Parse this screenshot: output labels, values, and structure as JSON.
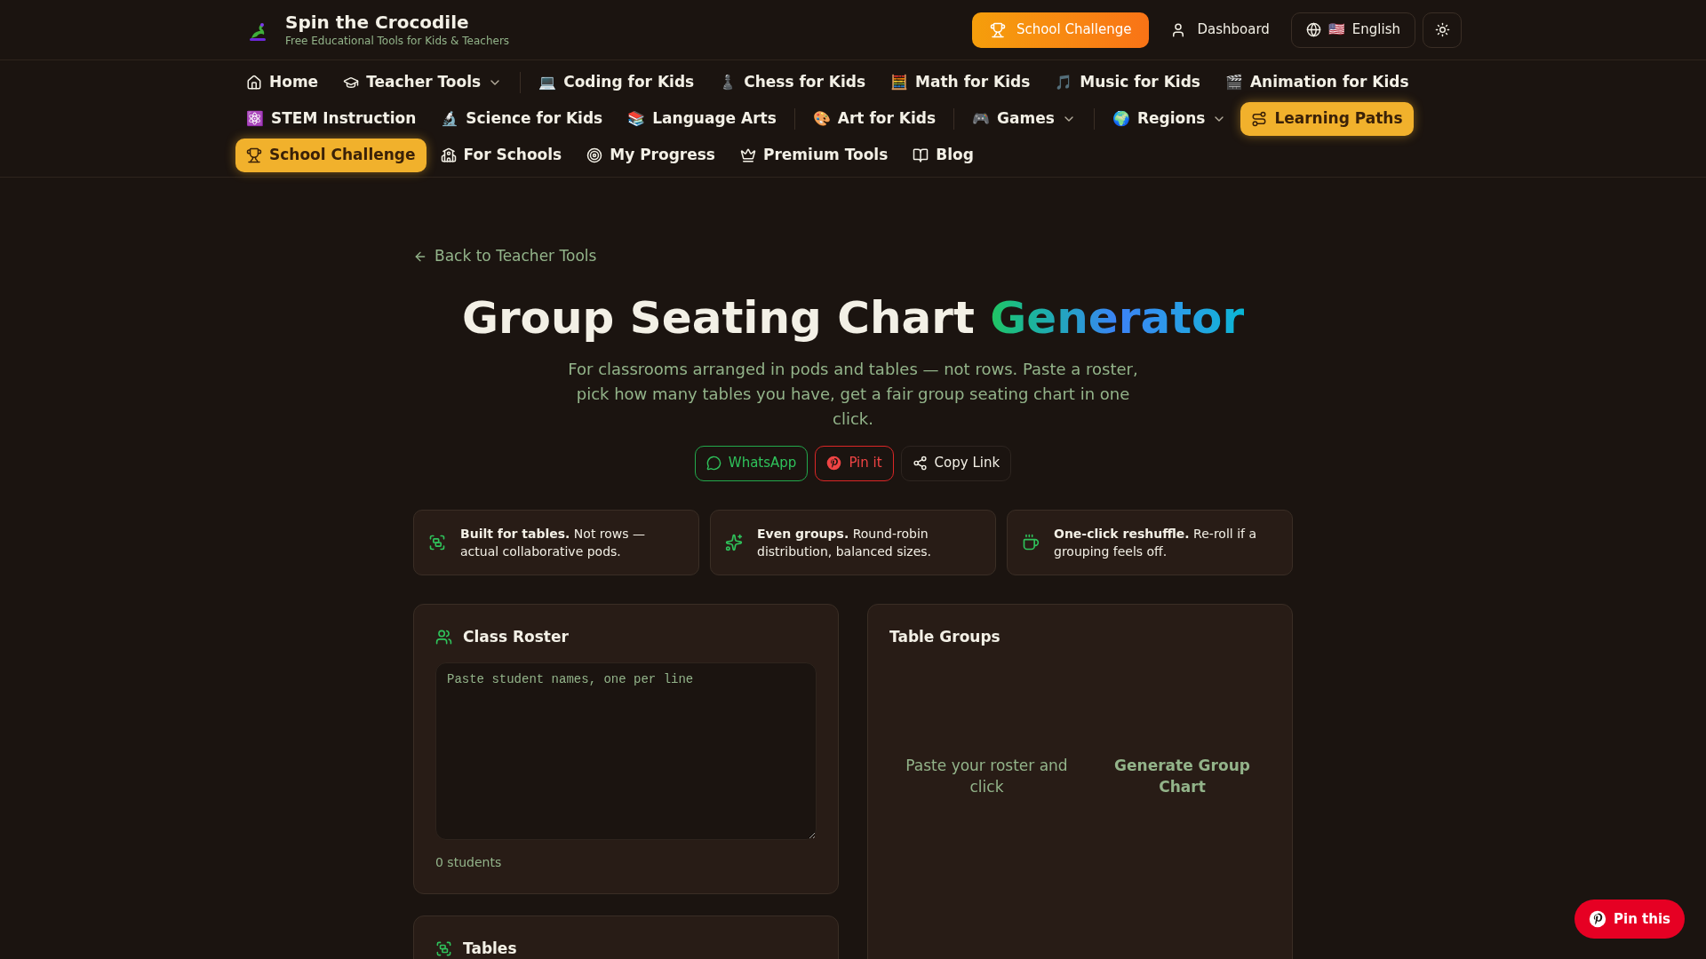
{
  "brand": {
    "name": "Spin the Crocodile",
    "tagline": "Free Educational Tools for Kids & Teachers"
  },
  "header_actions": [
    {
      "kind": "challenge",
      "label": "School Challenge"
    },
    {
      "kind": "dashboard",
      "label": "Dashboard"
    },
    {
      "kind": "language",
      "flag": "🇺🇸",
      "label": "English"
    },
    {
      "kind": "theme"
    }
  ],
  "nav_rows": [
    [
      {
        "kind": "home",
        "label": "Home",
        "dropdown": false,
        "highlighted": false,
        "divider_before": false
      },
      {
        "kind": "cap",
        "label": "Teacher Tools",
        "dropdown": true,
        "highlighted": false,
        "divider_before": false
      },
      {
        "kind": "emoji",
        "emoji": "💻",
        "label": "Coding for Kids",
        "dropdown": false,
        "highlighted": false,
        "divider_before": true
      },
      {
        "kind": "emoji",
        "emoji": "♟️",
        "label": "Chess for Kids",
        "dropdown": false,
        "highlighted": false,
        "divider_before": false
      },
      {
        "kind": "emoji",
        "emoji": "🧮",
        "label": "Math for Kids",
        "dropdown": false,
        "highlighted": false,
        "divider_before": false
      },
      {
        "kind": "emoji",
        "emoji": "🎵",
        "label": "Music for Kids",
        "dropdown": false,
        "highlighted": false,
        "divider_before": false
      },
      {
        "kind": "emoji",
        "emoji": "🎬",
        "label": "Animation for Kids",
        "dropdown": false,
        "highlighted": false,
        "divider_before": false
      }
    ],
    [
      {
        "kind": "emoji",
        "emoji": "⚛️",
        "label": "STEM Instruction",
        "dropdown": false,
        "highlighted": false,
        "divider_before": false
      },
      {
        "kind": "emoji",
        "emoji": "🔬",
        "label": "Science for Kids",
        "dropdown": false,
        "highlighted": false,
        "divider_before": false
      },
      {
        "kind": "emoji",
        "emoji": "📚",
        "label": "Language Arts",
        "dropdown": false,
        "highlighted": false,
        "divider_before": false
      },
      {
        "kind": "emoji",
        "emoji": "🎨",
        "label": "Art for Kids",
        "dropdown": false,
        "highlighted": false,
        "divider_before": true
      },
      {
        "kind": "emoji",
        "emoji": "🎮",
        "label": "Games",
        "dropdown": true,
        "highlighted": false,
        "divider_before": true
      },
      {
        "kind": "emoji",
        "emoji": "🌍",
        "label": "Regions",
        "dropdown": true,
        "highlighted": false,
        "divider_before": true
      },
      {
        "kind": "paths",
        "label": "Learning Paths",
        "dropdown": false,
        "highlighted": true,
        "divider_before": false
      }
    ],
    [
      {
        "kind": "trophy",
        "label": "School Challenge",
        "dropdown": false,
        "highlighted": true,
        "divider_before": false
      },
      {
        "kind": "school",
        "label": "For Schools",
        "dropdown": false,
        "highlighted": false,
        "divider_before": false
      },
      {
        "kind": "target",
        "label": "My Progress",
        "dropdown": false,
        "highlighted": false,
        "divider_before": false
      },
      {
        "kind": "crown",
        "label": "Premium Tools",
        "dropdown": false,
        "highlighted": false,
        "divider_before": false
      },
      {
        "kind": "book",
        "label": "Blog",
        "dropdown": false,
        "highlighted": false,
        "divider_before": false
      }
    ]
  ],
  "back_link": "Back to Teacher Tools",
  "title": {
    "plain": "Group Seating Chart",
    "accent": "Generator"
  },
  "intro": "For classrooms arranged in pods and tables — not rows. Paste a roster, pick how many tables you have, get a fair group seating chart in one click.",
  "share_buttons": [
    {
      "kind": "whatsapp",
      "label": "WhatsApp"
    },
    {
      "kind": "pinterest",
      "label": "Pin it"
    },
    {
      "kind": "copy",
      "label": "Copy Link"
    }
  ],
  "features": [
    {
      "kind": "tables",
      "text": "**Built for tables.** Not rows — actual collaborative pods."
    },
    {
      "kind": "sparkle",
      "text": "**Even groups.** Round-robin distribution, balanced sizes."
    },
    {
      "kind": "cup",
      "text": "**One-click reshuffle.** Re-roll if a grouping feels off."
    }
  ],
  "roster": {
    "title": "Class Roster",
    "placeholder": "Paste student names, one per line",
    "count": "0 students"
  },
  "tables_panel": {
    "title": "Tables"
  },
  "groups_panel": {
    "title": "Table Groups",
    "empty_text": "Paste your roster and click",
    "empty_action": "Generate Group Chart"
  },
  "floating_button": {
    "label": "Pin this"
  }
}
